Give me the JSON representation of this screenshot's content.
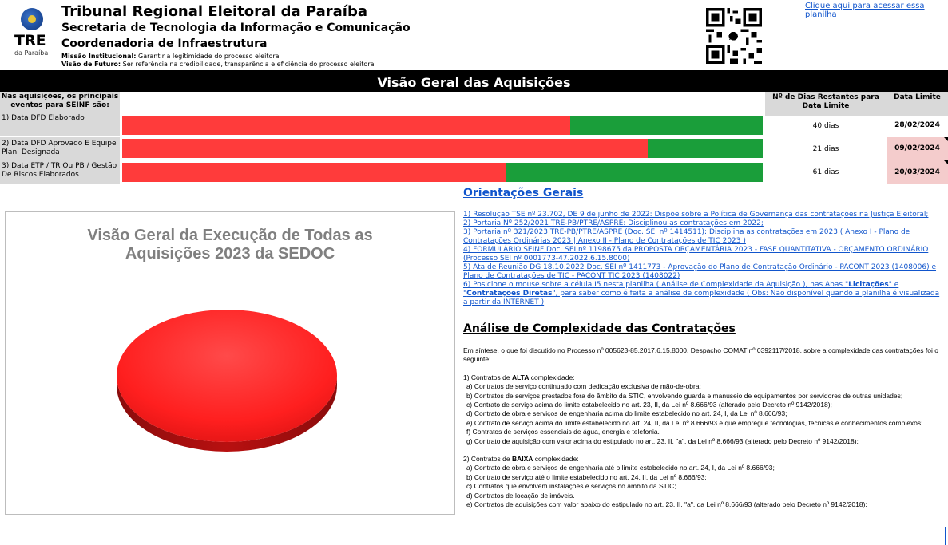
{
  "header": {
    "logo_text": "TRE",
    "logo_subtext": "da Paraíba",
    "title": "Tribunal Regional Eleitoral da Paraíba",
    "subtitle1": "Secretaria de Tecnologia da Informação e Comunicação",
    "subtitle2": "Coordenadoria de Infraestrutura",
    "mission_label": "Missão Institucional:",
    "mission_text": " Garantir a legitimidade do processo eleitoral",
    "vision_label": "Visão de Futuro:",
    "vision_text": " Ser referência na credibilidade, transparência e eficiência do processo eleitoral",
    "top_link": "Clique aqui para acessar essa planilha"
  },
  "banner": {
    "title": "Visão Geral das Aquisições"
  },
  "events": {
    "header": "Nas aquisições, os principais eventos para SEINF são:",
    "dias_header": "Nº de Dias Restantes para Data Limite",
    "date_header": "Data Limite",
    "rows": [
      {
        "label": "1) Data DFD Elaborado",
        "dias": "40 dias",
        "date": "28/02/2024",
        "elapsed": 0.7,
        "alert": false
      },
      {
        "label": "2) Data DFD Aprovado E Equipe Plan. Designada",
        "dias": "21 dias",
        "date": "09/02/2024",
        "elapsed": 0.82,
        "alert": true
      },
      {
        "label": "3) Data ETP / TR Ou PB / Gestão De Riscos Elaborados",
        "dias": "61 dias",
        "date": "20/03/2024",
        "elapsed": 0.6,
        "alert": true
      }
    ]
  },
  "chart": {
    "title_line1": "Visão Geral da Execução de Todas as",
    "title_line2": "Aquisições 2023 da SEDOC"
  },
  "chart_data": {
    "type": "pie",
    "title": "Visão Geral da Execução de Todas as Aquisições 2023 da SEDOC",
    "series": [
      {
        "values": [
          100
        ],
        "colors": [
          "#ff1f1f"
        ]
      }
    ]
  },
  "orientacoes": {
    "heading": "Orientações Gerais",
    "items": [
      "1) Resolução TSE nº 23.702, DE 9 de junho de 2022: Dispõe sobre a Política de Governança das contratações na Justiça Eleitoral;",
      "2) Portaria Nº 252/2021 TRE-PB/PTRE/ASPRE: Disciplinou as contratações em 2022;",
      "3) Portaria nº 321/2023 TRE-PB/PTRE/ASPRE (Doc. SEI nº 1414511): Disciplina as contratações em 2023 ( Anexo I - Plano de Contratações Ordinárias 2023 | Anexo II - Plano de Contratações de TIC 2023 )",
      "4) FORMULÁRIO SEINF Doc. SEI nº 1198675 da PROPOSTA ORÇAMENTÁRIA 2023 - FASE QUANTITATIVA - ORÇAMENTO ORDINÁRIO (Processo SEI nº 0001773-47.2022.6.15.8000)",
      "5) Ata de Reunião DG 18.10.2022 Doc. SEI nº 1411773 - Aprovação do Plano de Contratação Ordinário - PACONT 2023 (1408006) e Plano de Contratações de TIC - PACONT TIC 2023 (1408022)"
    ],
    "item6_a": "6) Posicione o mouse sobre a célula I5 nesta planilha ( Análise de Complexidade da Aquisição ), nas Abas \"",
    "item6_b": "Licitações",
    "item6_c": "\" e \"",
    "item6_d": "Contratações Diretas",
    "item6_e": "\", para saber como é feita a análise de complexidade ( Obs: Não disponível quando a planilha é visualizada a partir da INTERNET )"
  },
  "analise": {
    "heading": "Análise de Complexidade das Contratações",
    "intro": "Em síntese, o que foi discutido no Processo nº 005623-85.2017.6.15.8000, Despacho COMAT nº 0392117/2018, sobre a complexidade das contratações foi o seguinte:",
    "alta_pre": "1) Contratos de ",
    "alta_word": "ALTA",
    "alta_post": " complexidade:",
    "alta_items": [
      "a) Contratos de serviço continuado com dedicação exclusiva de mão-de-obra;",
      "b) Contratos de serviços prestados fora do âmbito da STIC, envolvendo guarda e manuseio de equipamentos por servidores de outras unidades;",
      "c) Contrato de serviço acima do limite  estabelecido no art. 23, II, da Lei nº 8.666/93 (alterado pelo Decreto nº 9142/2018);",
      "d) Contrato de obra e serviços de engenharia acima do limite estabelecido no art. 24, I, da Lei nº 8.666/93;",
      "e) Contrato de serviço acima do limite  estabelecido no art. 24, II, da Lei nº 8.666/93 e que empregue tecnologias, técnicas e conhecimentos complexos;",
      "f) Contratos de serviços essenciais de água, energia e telefonia.",
      "g) Contrato de aquisição com valor acima do estipulado no art. 23, II, \"a\", da Lei nº 8.666/93 (alterado pelo Decreto nº 9142/2018);"
    ],
    "baixa_pre": "2) Contratos de ",
    "baixa_word": "BAIXA",
    "baixa_post": " complexidade:",
    "baixa_items": [
      "a) Contrato de obra e serviços de engenharia até o limite estabelecido no art. 24, I, da Lei nº 8.666/93;",
      "b) Contrato de serviço até o limite  estabelecido no art. 24, II, da Lei nº 8.666/93;",
      "c) Contratos que envolvem instalações e serviços no âmbito da STIC;",
      "d) Contratos de locação de imóveis.",
      "e) Contratos de aquisições com valor abaixo do estipulado no art. 23, II, \"a\", da Lei nº 8.666/93 (alterado pelo Decreto nº 9142/2018);"
    ]
  }
}
